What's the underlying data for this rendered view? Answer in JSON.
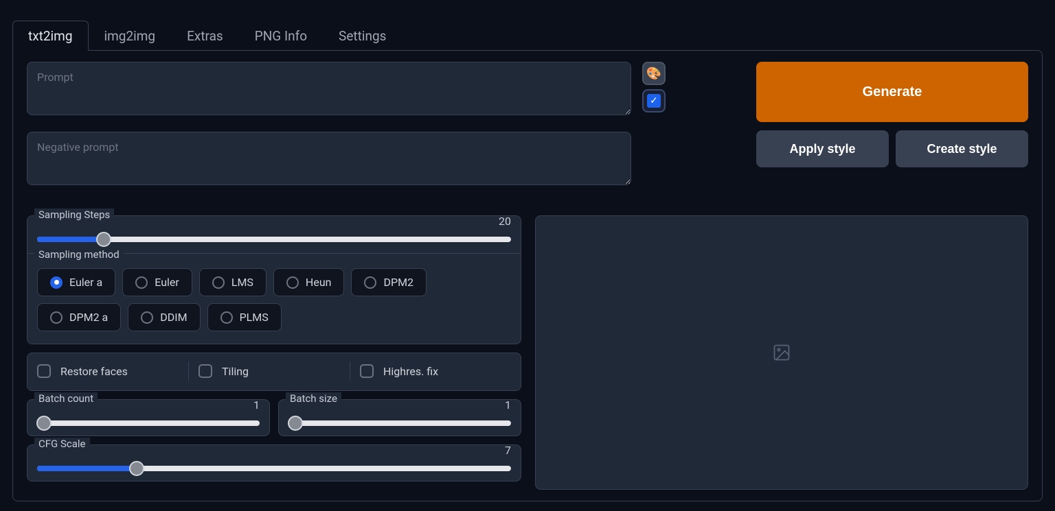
{
  "tabs": [
    {
      "label": "txt2img",
      "active": true
    },
    {
      "label": "img2img",
      "active": false
    },
    {
      "label": "Extras",
      "active": false
    },
    {
      "label": "PNG Info",
      "active": false
    },
    {
      "label": "Settings",
      "active": false
    }
  ],
  "prompt": {
    "placeholder": "Prompt",
    "value": ""
  },
  "negative_prompt": {
    "placeholder": "Negative prompt",
    "value": ""
  },
  "buttons": {
    "generate": "Generate",
    "apply_style": "Apply style",
    "create_style": "Create style"
  },
  "sampling_steps": {
    "label": "Sampling Steps",
    "value": "20",
    "fill_percent": 14
  },
  "sampling_method": {
    "label": "Sampling method",
    "options": [
      "Euler a",
      "Euler",
      "LMS",
      "Heun",
      "DPM2",
      "DPM2 a",
      "DDIM",
      "PLMS"
    ],
    "selected": "Euler a"
  },
  "checkboxes": {
    "restore_faces": "Restore faces",
    "tiling": "Tiling",
    "highres_fix": "Highres. fix"
  },
  "batch_count": {
    "label": "Batch count",
    "value": "1",
    "fill_percent": 0
  },
  "batch_size": {
    "label": "Batch size",
    "value": "1",
    "fill_percent": 0
  },
  "cfg_scale": {
    "label": "CFG Scale",
    "value": "7",
    "fill_percent": 21
  }
}
